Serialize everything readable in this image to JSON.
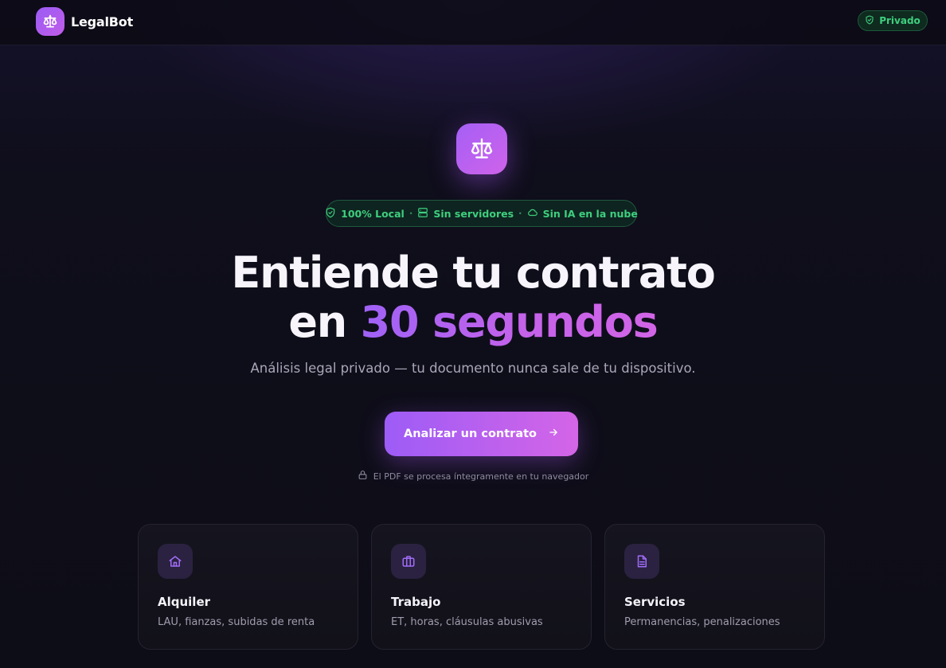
{
  "header": {
    "brand_name": "LegalBot",
    "brand_icon": "scales-icon",
    "private_badge": "Privado",
    "private_icon": "shield-check-icon"
  },
  "hero": {
    "icon": "scales-icon",
    "badges": [
      {
        "icon": "shield-check-icon",
        "label": "100% Local"
      },
      {
        "icon": "server-icon",
        "label": "Sin servidores"
      },
      {
        "icon": "cloud-icon",
        "label": "Sin IA en la nube"
      }
    ],
    "separator": "·",
    "title_line1": "Entiende tu contrato",
    "title_line2_prefix": "en ",
    "title_line2_highlight": "30 segundos",
    "subtitle": "Análisis legal privado — tu documento nunca sale de tu dispositivo.",
    "cta_label": "Analizar un contrato",
    "cta_icon": "arrow-right-icon",
    "note_icon": "lock-icon",
    "note": "El PDF se procesa íntegramente en tu navegador"
  },
  "cards": [
    {
      "icon": "home-icon",
      "title": "Alquiler",
      "description": "LAU, fianzas, subidas de renta"
    },
    {
      "icon": "briefcase-icon",
      "title": "Trabajo",
      "description": "ET, horas, cláusulas abusivas"
    },
    {
      "icon": "document-icon",
      "title": "Servicios",
      "description": "Permanencias, penalizaciones"
    }
  ],
  "colors": {
    "accent_start": "#9d5cf6",
    "accent_end": "#d465e7",
    "success_green": "#3ecf7e",
    "background": "#0d0c16"
  }
}
